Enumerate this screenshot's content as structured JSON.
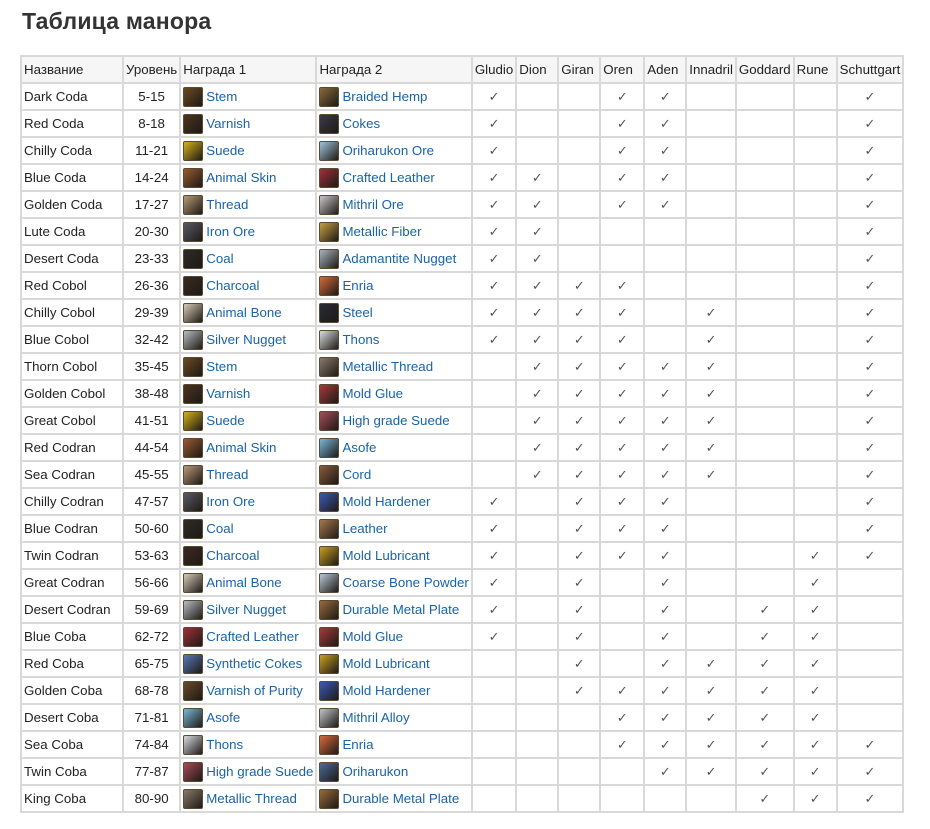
{
  "title": "Таблица манора",
  "columns": {
    "name": "Название",
    "level": "Уровень",
    "reward1": "Награда 1",
    "reward2": "Награда 2",
    "towns": [
      "Gludio",
      "Dion",
      "Giran",
      "Oren",
      "Aden",
      "Innadril",
      "Goddard",
      "Rune",
      "Schuttgart"
    ]
  },
  "check_symbol": "✓",
  "rows": [
    {
      "name": "Dark Coda",
      "level": "5-15",
      "r1": "Stem",
      "r1_icon": "stem-icon",
      "r2": "Braided Hemp",
      "r2_icon": "braided-hemp-icon",
      "towns": [
        1,
        0,
        0,
        1,
        1,
        0,
        0,
        0,
        1
      ]
    },
    {
      "name": "Red Coda",
      "level": "8-18",
      "r1": "Varnish",
      "r1_icon": "varnish-icon",
      "r2": "Cokes",
      "r2_icon": "cokes-icon",
      "towns": [
        1,
        0,
        0,
        1,
        1,
        0,
        0,
        0,
        1
      ]
    },
    {
      "name": "Chilly Coda",
      "level": "11-21",
      "r1": "Suede",
      "r1_icon": "suede-icon",
      "r2": "Oriharukon Ore",
      "r2_icon": "oriharukon-ore-icon",
      "towns": [
        1,
        0,
        0,
        1,
        1,
        0,
        0,
        0,
        1
      ]
    },
    {
      "name": "Blue Coda",
      "level": "14-24",
      "r1": "Animal Skin",
      "r1_icon": "animal-skin-icon",
      "r2": "Crafted Leather",
      "r2_icon": "crafted-leather-icon",
      "towns": [
        1,
        1,
        0,
        1,
        1,
        0,
        0,
        0,
        1
      ]
    },
    {
      "name": "Golden Coda",
      "level": "17-27",
      "r1": "Thread",
      "r1_icon": "thread-icon",
      "r2": "Mithril Ore",
      "r2_icon": "mithril-ore-icon",
      "towns": [
        1,
        1,
        0,
        1,
        1,
        0,
        0,
        0,
        1
      ]
    },
    {
      "name": "Lute Coda",
      "level": "20-30",
      "r1": "Iron Ore",
      "r1_icon": "iron-ore-icon",
      "r2": "Metallic Fiber",
      "r2_icon": "metallic-fiber-icon",
      "towns": [
        1,
        1,
        0,
        0,
        0,
        0,
        0,
        0,
        1
      ]
    },
    {
      "name": "Desert Coda",
      "level": "23-33",
      "r1": "Coal",
      "r1_icon": "coal-icon",
      "r2": "Adamantite Nugget",
      "r2_icon": "adamantite-nugget-icon",
      "towns": [
        1,
        1,
        0,
        0,
        0,
        0,
        0,
        0,
        1
      ]
    },
    {
      "name": "Red Cobol",
      "level": "26-36",
      "r1": "Charcoal",
      "r1_icon": "charcoal-icon",
      "r2": "Enria",
      "r2_icon": "enria-icon",
      "towns": [
        1,
        1,
        1,
        1,
        0,
        0,
        0,
        0,
        1
      ]
    },
    {
      "name": "Chilly Cobol",
      "level": "29-39",
      "r1": "Animal Bone",
      "r1_icon": "animal-bone-icon",
      "r2": "Steel",
      "r2_icon": "steel-icon",
      "towns": [
        1,
        1,
        1,
        1,
        0,
        1,
        0,
        0,
        1
      ]
    },
    {
      "name": "Blue Cobol",
      "level": "32-42",
      "r1": "Silver Nugget",
      "r1_icon": "silver-nugget-icon",
      "r2": "Thons",
      "r2_icon": "thons-icon",
      "towns": [
        1,
        1,
        1,
        1,
        0,
        1,
        0,
        0,
        1
      ]
    },
    {
      "name": "Thorn Cobol",
      "level": "35-45",
      "r1": "Stem",
      "r1_icon": "stem-icon",
      "r2": "Metallic Thread",
      "r2_icon": "metallic-thread-icon",
      "towns": [
        0,
        1,
        1,
        1,
        1,
        1,
        0,
        0,
        1
      ]
    },
    {
      "name": "Golden Cobol",
      "level": "38-48",
      "r1": "Varnish",
      "r1_icon": "varnish-icon",
      "r2": "Mold Glue",
      "r2_icon": "mold-glue-icon",
      "towns": [
        0,
        1,
        1,
        1,
        1,
        1,
        0,
        0,
        1
      ]
    },
    {
      "name": "Great Cobol",
      "level": "41-51",
      "r1": "Suede",
      "r1_icon": "suede-icon",
      "r2": "High grade Suede",
      "r2_icon": "high-grade-suede-icon",
      "towns": [
        0,
        1,
        1,
        1,
        1,
        1,
        0,
        0,
        1
      ]
    },
    {
      "name": "Red Codran",
      "level": "44-54",
      "r1": "Animal Skin",
      "r1_icon": "animal-skin-icon",
      "r2": "Asofe",
      "r2_icon": "asofe-icon",
      "towns": [
        0,
        1,
        1,
        1,
        1,
        1,
        0,
        0,
        1
      ]
    },
    {
      "name": "Sea Codran",
      "level": "45-55",
      "r1": "Thread",
      "r1_icon": "thread-icon",
      "r2": "Cord",
      "r2_icon": "cord-icon",
      "towns": [
        0,
        1,
        1,
        1,
        1,
        1,
        0,
        0,
        1
      ]
    },
    {
      "name": "Chilly Codran",
      "level": "47-57",
      "r1": "Iron Ore",
      "r1_icon": "iron-ore-icon",
      "r2": "Mold Hardener",
      "r2_icon": "mold-hardener-icon",
      "towns": [
        1,
        0,
        1,
        1,
        1,
        0,
        0,
        0,
        1
      ]
    },
    {
      "name": "Blue Codran",
      "level": "50-60",
      "r1": "Coal",
      "r1_icon": "coal-icon",
      "r2": "Leather",
      "r2_icon": "leather-icon",
      "towns": [
        1,
        0,
        1,
        1,
        1,
        0,
        0,
        0,
        1
      ]
    },
    {
      "name": "Twin Codran",
      "level": "53-63",
      "r1": "Charcoal",
      "r1_icon": "charcoal-icon",
      "r2": "Mold Lubricant",
      "r2_icon": "mold-lubricant-icon",
      "towns": [
        1,
        0,
        1,
        1,
        1,
        0,
        0,
        1,
        1
      ]
    },
    {
      "name": "Great Codran",
      "level": "56-66",
      "r1": "Animal Bone",
      "r1_icon": "animal-bone-icon",
      "r2": "Coarse Bone Powder",
      "r2_icon": "coarse-bone-powder-icon",
      "towns": [
        1,
        0,
        1,
        0,
        1,
        0,
        0,
        1,
        0
      ]
    },
    {
      "name": "Desert Codran",
      "level": "59-69",
      "r1": "Silver Nugget",
      "r1_icon": "silver-nugget-icon",
      "r2": "Durable Metal Plate",
      "r2_icon": "durable-metal-plate-icon",
      "towns": [
        1,
        0,
        1,
        0,
        1,
        0,
        1,
        1,
        0
      ]
    },
    {
      "name": "Blue Coba",
      "level": "62-72",
      "r1": "Crafted Leather",
      "r1_icon": "crafted-leather-icon",
      "r2": "Mold Glue",
      "r2_icon": "mold-glue-icon",
      "towns": [
        1,
        0,
        1,
        0,
        1,
        0,
        1,
        1,
        0
      ]
    },
    {
      "name": "Red Coba",
      "level": "65-75",
      "r1": "Synthetic Cokes",
      "r1_icon": "synthetic-cokes-icon",
      "r2": "Mold Lubricant",
      "r2_icon": "mold-lubricant-icon",
      "towns": [
        0,
        0,
        1,
        0,
        1,
        1,
        1,
        1,
        0
      ]
    },
    {
      "name": "Golden Coba",
      "level": "68-78",
      "r1": "Varnish of Purity",
      "r1_icon": "varnish-of-purity-icon",
      "r2": "Mold Hardener",
      "r2_icon": "mold-hardener-icon",
      "towns": [
        0,
        0,
        1,
        1,
        1,
        1,
        1,
        1,
        0
      ]
    },
    {
      "name": "Desert Coba",
      "level": "71-81",
      "r1": "Asofe",
      "r1_icon": "asofe-icon",
      "r2": "Mithril Alloy",
      "r2_icon": "mithril-alloy-icon",
      "towns": [
        0,
        0,
        0,
        1,
        1,
        1,
        1,
        1,
        0
      ]
    },
    {
      "name": "Sea Coba",
      "level": "74-84",
      "r1": "Thons",
      "r1_icon": "thons-icon",
      "r2": "Enria",
      "r2_icon": "enria-icon",
      "towns": [
        0,
        0,
        0,
        1,
        1,
        1,
        1,
        1,
        1
      ]
    },
    {
      "name": "Twin Coba",
      "level": "77-87",
      "r1": "High grade Suede",
      "r1_icon": "high-grade-suede-icon",
      "r2": "Oriharukon",
      "r2_icon": "oriharukon-icon",
      "towns": [
        0,
        0,
        0,
        0,
        1,
        1,
        1,
        1,
        1
      ]
    },
    {
      "name": "King Coba",
      "level": "80-90",
      "r1": "Metallic Thread",
      "r1_icon": "metallic-thread-icon",
      "r2": "Durable Metal Plate",
      "r2_icon": "durable-metal-plate-icon",
      "towns": [
        0,
        0,
        0,
        0,
        0,
        0,
        1,
        1,
        1
      ]
    }
  ],
  "icon_colors": {
    "stem-icon": "#6b4a22",
    "braided-hemp-icon": "#8a6a3a",
    "varnish-icon": "#4a3420",
    "cokes-icon": "#3a3a4a",
    "suede-icon": "#d8b21a",
    "oriharukon-ore-icon": "#9fc4d8",
    "animal-skin-icon": "#9a5a32",
    "crafted-leather-icon": "#a0303a",
    "thread-icon": "#b89a78",
    "mithril-ore-icon": "#c8c8c8",
    "iron-ore-icon": "#5a5a66",
    "metallic-fiber-icon": "#c8a040",
    "coal-icon": "#2e2a26",
    "adamantite-nugget-icon": "#a8b4c0",
    "charcoal-icon": "#3a2a22",
    "enria-icon": "#d86a3a",
    "animal-bone-icon": "#d8ccb8",
    "steel-icon": "#282c34",
    "silver-nugget-icon": "#b8bcc4",
    "thons-icon": "#d8dce0",
    "metallic-thread-icon": "#8a7a6a",
    "mold-glue-icon": "#a83a3a",
    "high-grade-suede-icon": "#a84a5a",
    "asofe-icon": "#7ab8d8",
    "cord-icon": "#8a5a3a",
    "mold-hardener-icon": "#3a5ab8",
    "leather-icon": "#a8784a",
    "mold-lubricant-icon": "#c8a020",
    "coarse-bone-powder-icon": "#b8c8d8",
    "durable-metal-plate-icon": "#9a6a3a",
    "synthetic-cokes-icon": "#5a7ab8",
    "varnish-of-purity-icon": "#6a4a2a",
    "mithril-alloy-icon": "#c0c4c8",
    "oriharukon-icon": "#4a6a9a"
  },
  "link_color": "#1a63a8"
}
